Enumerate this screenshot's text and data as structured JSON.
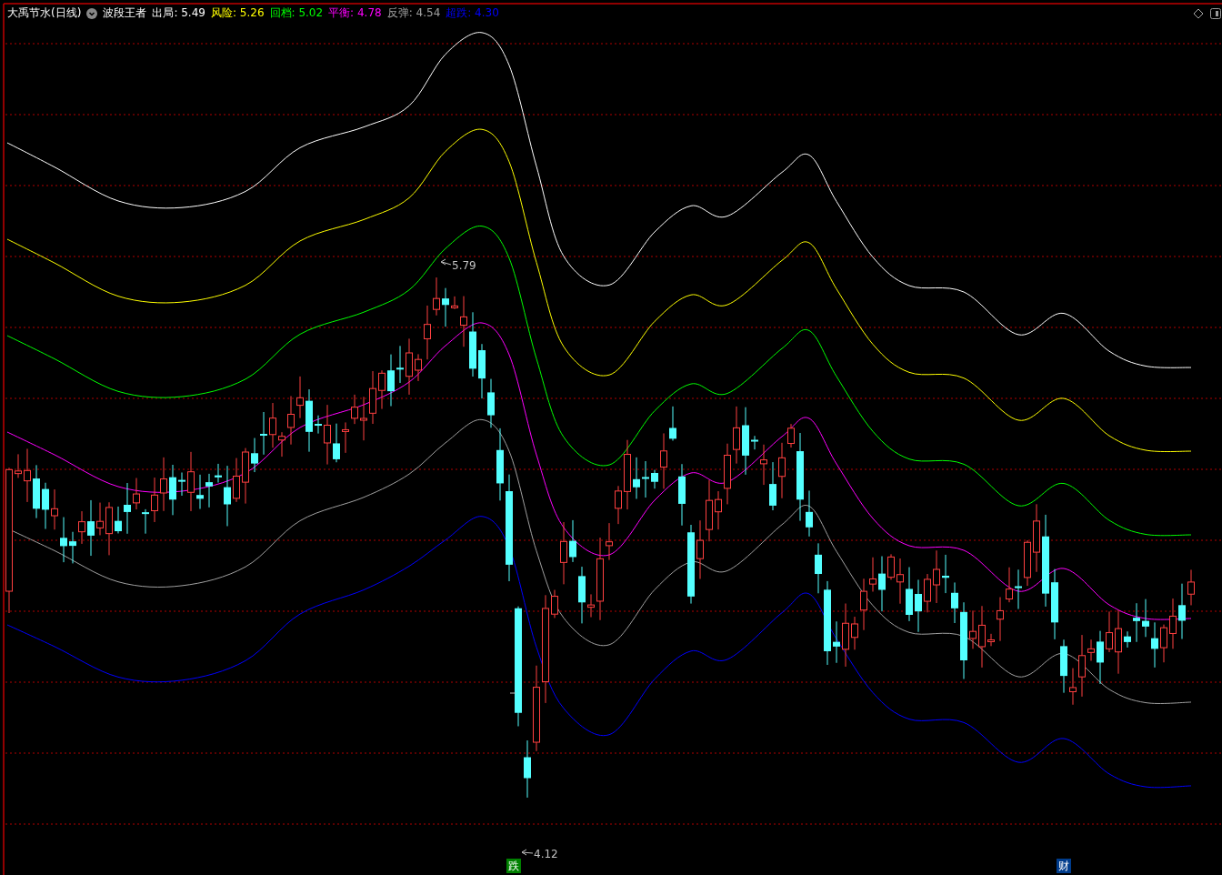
{
  "header": {
    "title": "大禹节水(日线)",
    "indicator": "波段王者",
    "values": [
      {
        "label": "出局:",
        "value": "5.49",
        "color": "#ffffff"
      },
      {
        "label": "风险:",
        "value": "5.26",
        "color": "#ffff00"
      },
      {
        "label": "回档:",
        "value": "5.02",
        "color": "#00ff00"
      },
      {
        "label": "平衡:",
        "value": "4.78",
        "color": "#ff00ff"
      },
      {
        "label": "反弹:",
        "value": "4.54",
        "color": "#a0a0a0"
      },
      {
        "label": "超跌:",
        "value": "4.30",
        "color": "#0000ff"
      }
    ]
  },
  "chart": {
    "high_label": "5.79",
    "low_label": "4.12"
  },
  "markers": [
    {
      "text": "跌",
      "color": "#008000"
    },
    {
      "text": "财",
      "color": "#003c8c"
    }
  ]
}
